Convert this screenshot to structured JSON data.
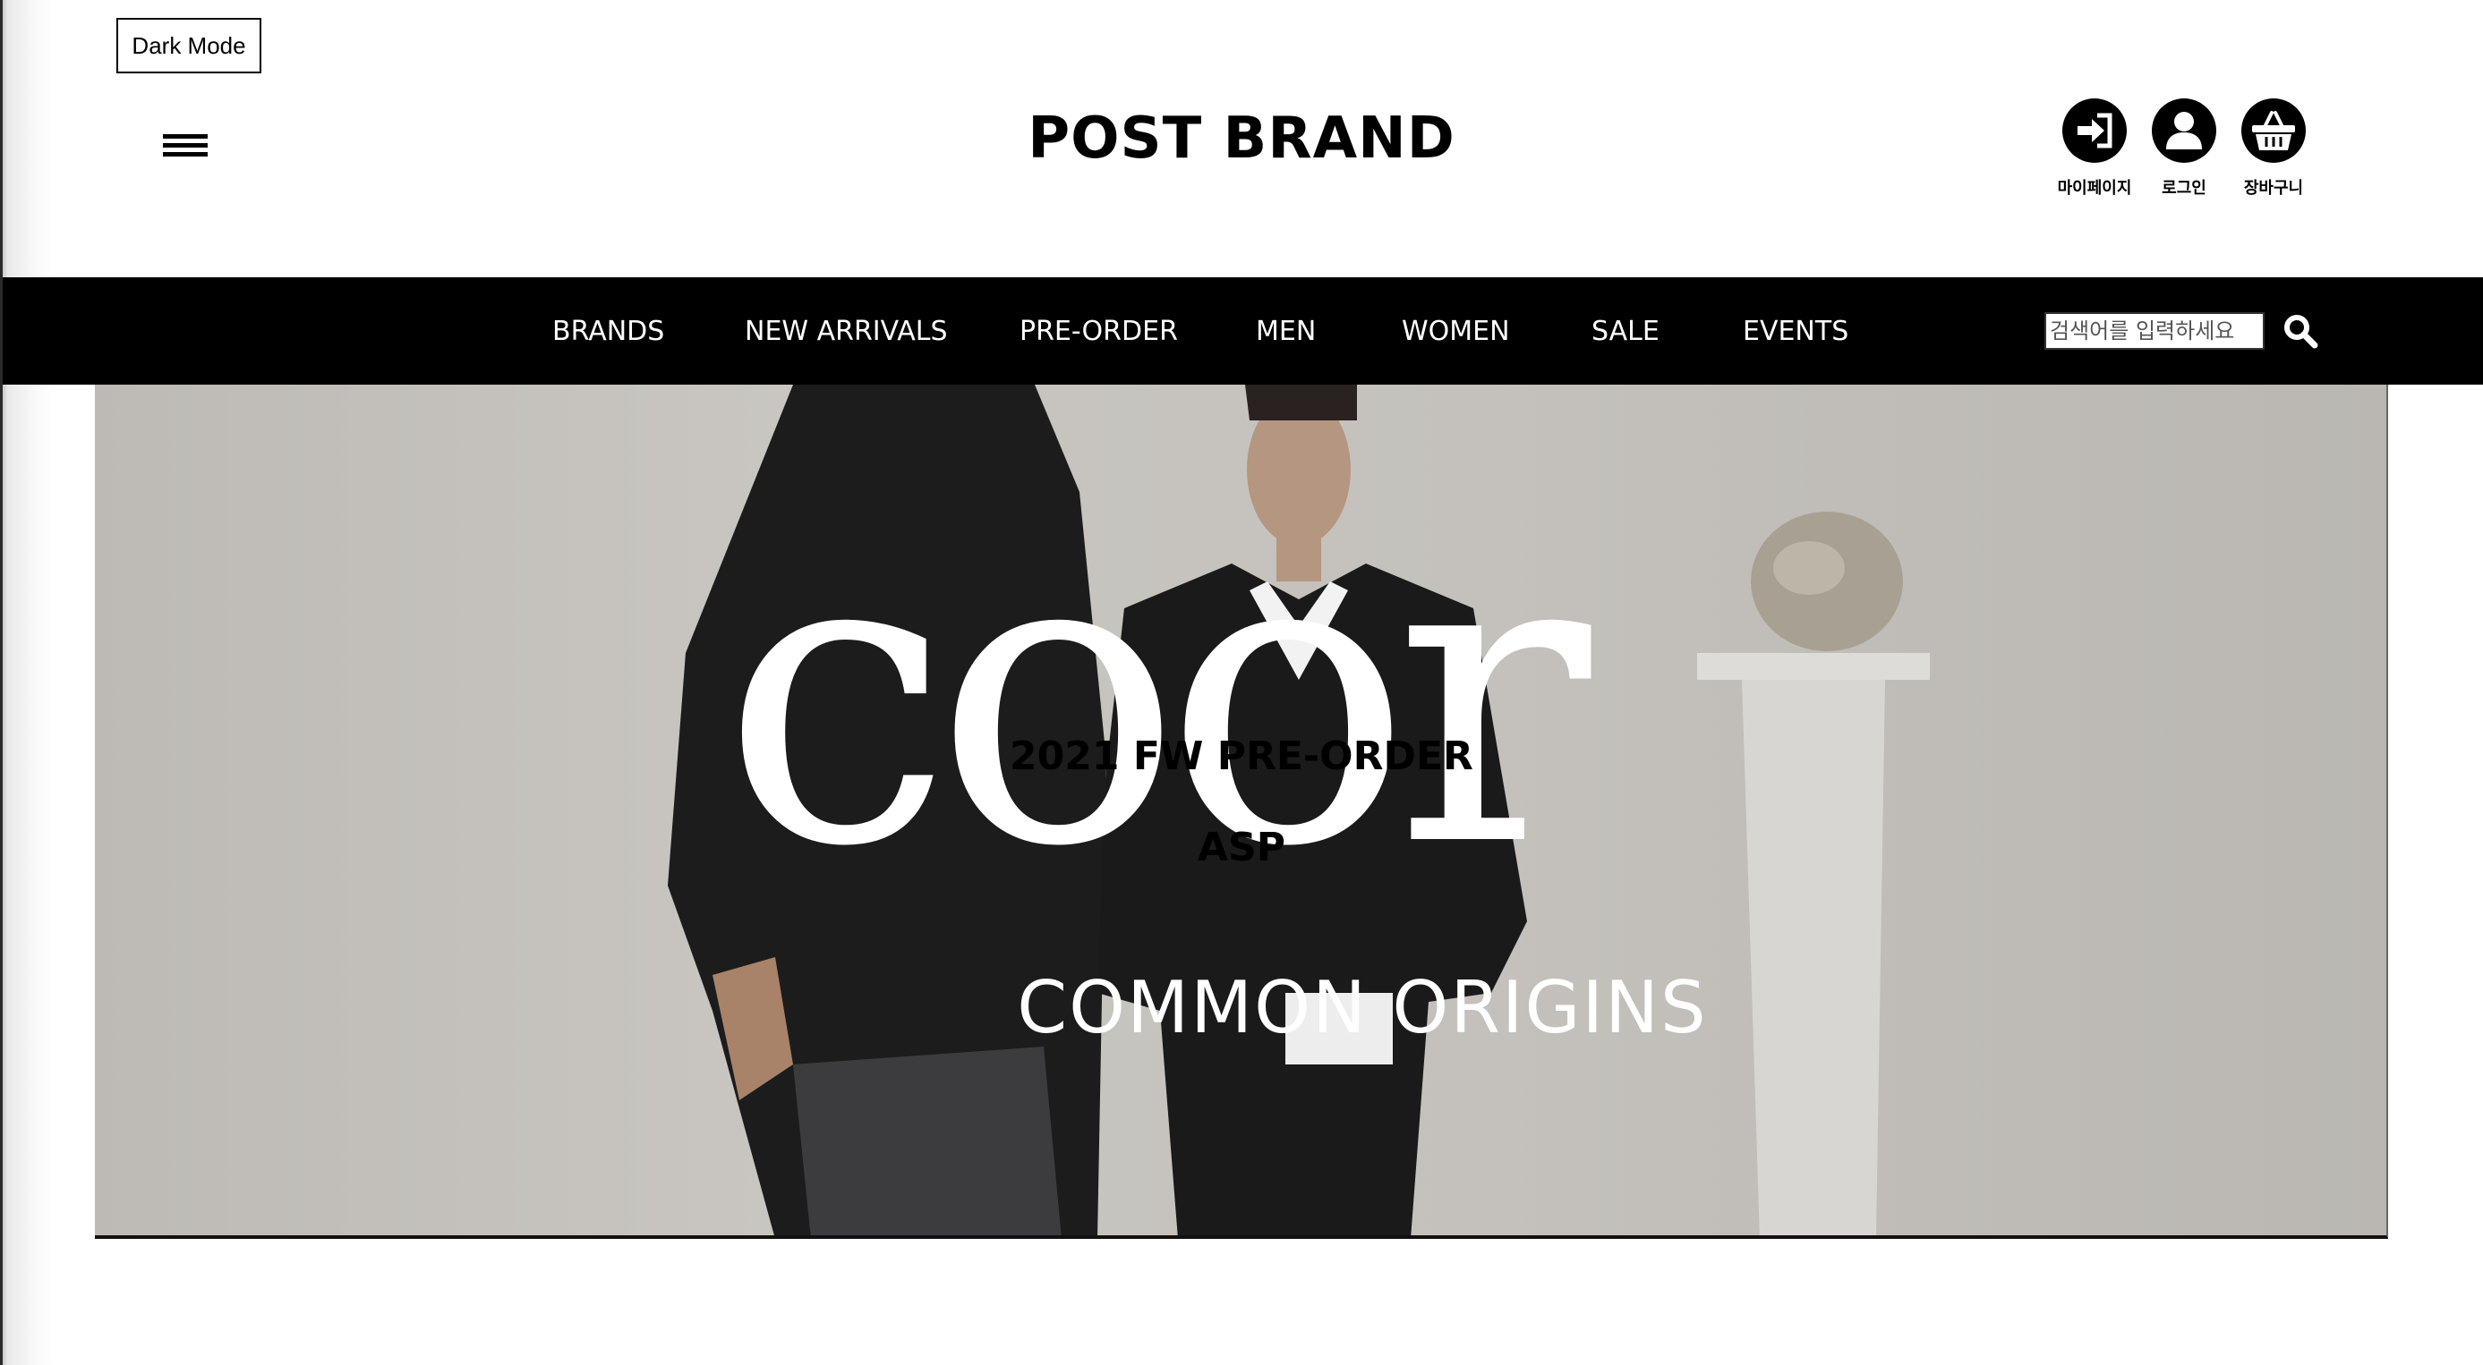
{
  "dark_mode_label": "Dark Mode",
  "brand": {
    "title": "POST BRAND"
  },
  "user_menu": [
    {
      "label": "마이페이지",
      "icon": "login-arrow-icon"
    },
    {
      "label": "로그인",
      "icon": "user-icon"
    },
    {
      "label": "장바구니",
      "icon": "basket-icon"
    }
  ],
  "nav": {
    "items": [
      "BRANDS",
      "NEW ARRIVALS",
      "PRE-ORDER",
      "MEN",
      "WOMEN",
      "SALE",
      "EVENTS"
    ],
    "search_placeholder": "검색어를 입력하세요",
    "search_icon": "search-icon"
  },
  "hero": {
    "logo_text": "coor",
    "subtitle": "COMMON ORIGINS",
    "caption_line1": "2021 FW PRE-ORDER",
    "caption_line2": "ASP"
  },
  "colors": {
    "navbar_bg": "#000000",
    "nav_text": "#ffffff",
    "page_bg": "#ffffff"
  }
}
